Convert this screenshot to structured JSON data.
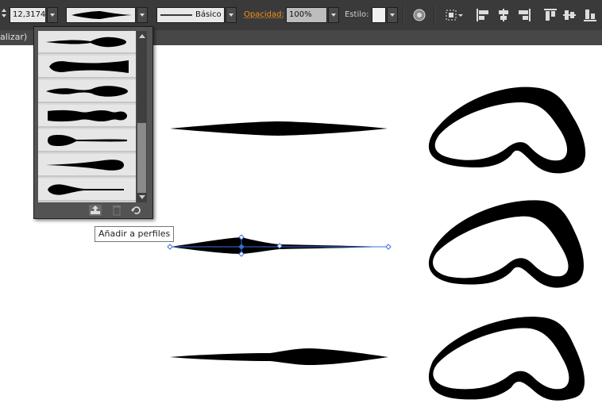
{
  "toolbar": {
    "stroke_weight": "12,3174",
    "brush_style": "Básico",
    "opacity_label": "Opacidad:",
    "opacity_value": "100%",
    "style_label": "Estilo:"
  },
  "docbar": {
    "title": "alizar)"
  },
  "profile_panel": {
    "items": [
      "profile-1",
      "profile-2",
      "profile-3",
      "profile-4",
      "profile-5",
      "profile-6",
      "profile-7"
    ],
    "buttons": [
      "add-to-profiles-icon",
      "delete-profile-icon",
      "reset-profiles-icon"
    ]
  },
  "tooltip": {
    "text": "Añadir a perfiles"
  }
}
